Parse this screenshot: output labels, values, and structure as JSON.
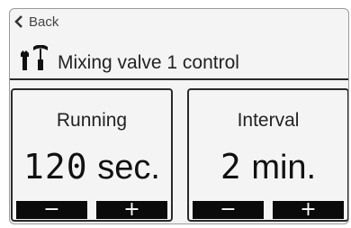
{
  "nav": {
    "back_label": "Back",
    "back_icon": "chevron-left-icon"
  },
  "header": {
    "title": "Mixing valve 1 control",
    "icon": "tools-icon"
  },
  "panels": [
    {
      "label": "Running",
      "value": "120",
      "unit": "sec.",
      "minus_label": "−",
      "plus_label": "+"
    },
    {
      "label": "Interval",
      "value": "2",
      "unit": "min.",
      "minus_label": "−",
      "plus_label": "+"
    }
  ],
  "colors": {
    "background": "#f4f4f4",
    "button": "#0a0a0a",
    "text": "#222222"
  }
}
